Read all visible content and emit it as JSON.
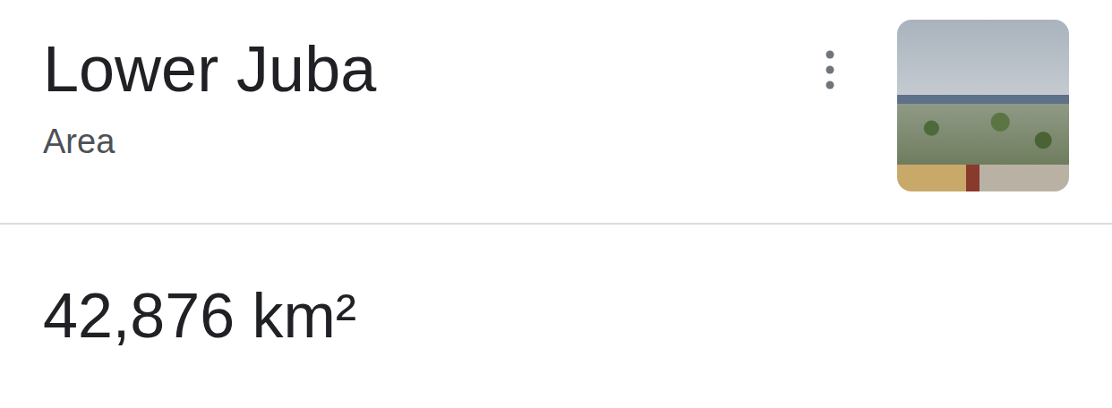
{
  "panel": {
    "title": "Lower Juba",
    "subtitle": "Area",
    "value": "42,876 km²"
  }
}
